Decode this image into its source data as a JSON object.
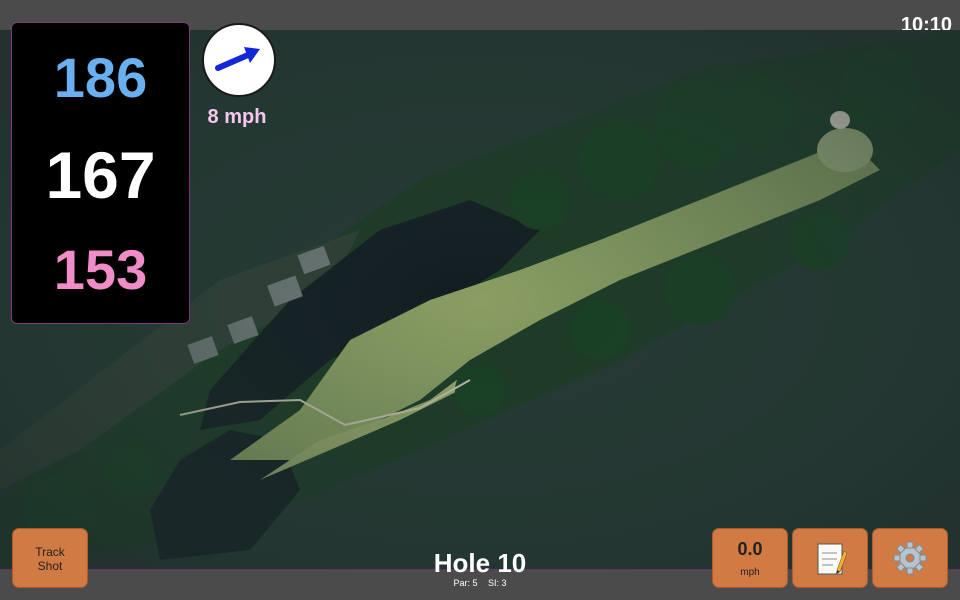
{
  "status": {
    "time": "10:10"
  },
  "distances": {
    "back": "186",
    "middle": "167",
    "front": "153"
  },
  "wind": {
    "speed_label": "8 mph",
    "icon": "wind-arrow-icon"
  },
  "hole": {
    "title": "Hole 10",
    "par_label": "Par: 5",
    "si_label": "SI: 3"
  },
  "buttons": {
    "track_line1": "Track",
    "track_line2": "Shot",
    "speed_value": "0.0",
    "speed_unit": "mph",
    "notes_icon": "notepad-icon",
    "settings_icon": "gear-icon"
  },
  "colors": {
    "back_distance": "#6ab0f0",
    "middle_distance": "#ffffff",
    "front_distance": "#f08cc8",
    "button_fill": "#d27a43",
    "bar_accent": "#6e2d6e"
  }
}
